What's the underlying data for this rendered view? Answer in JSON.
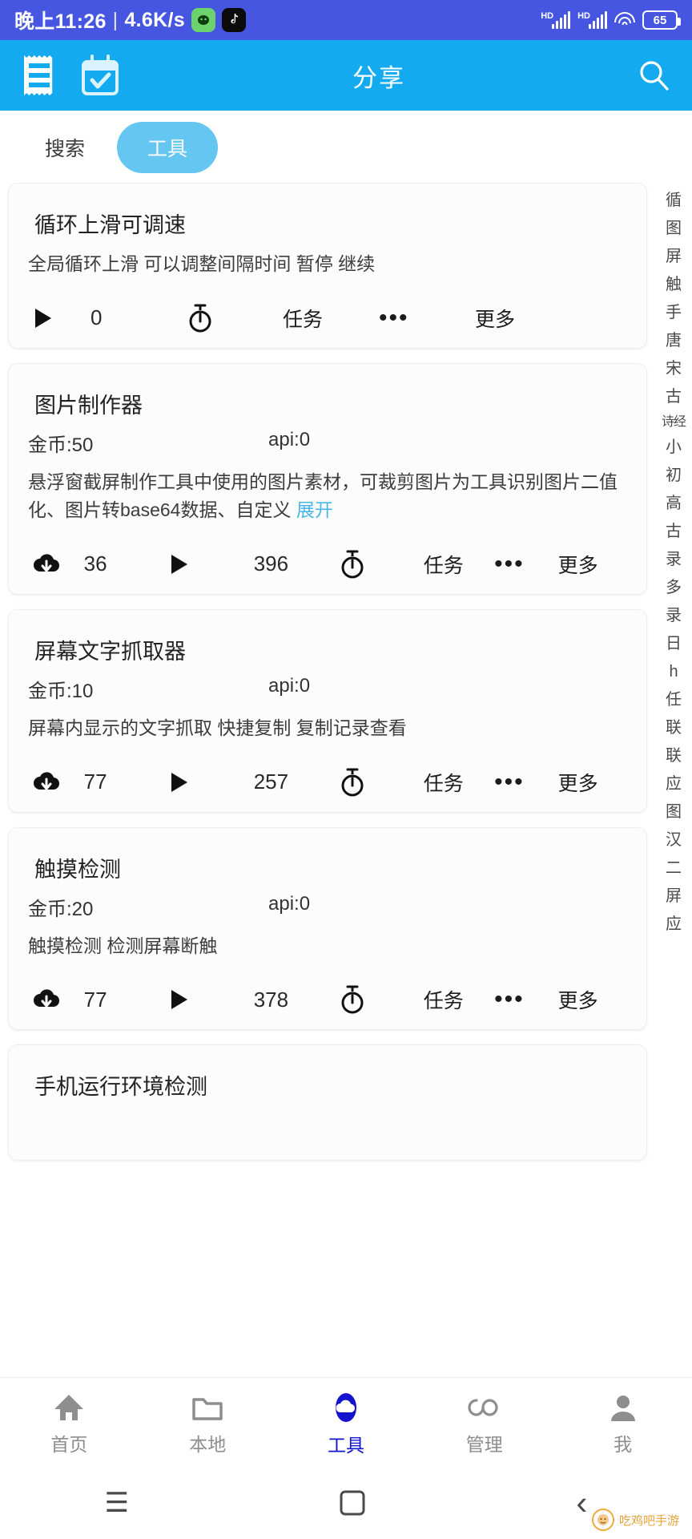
{
  "status_bar": {
    "time": "晚上11:26",
    "separator": "|",
    "network_speed": "4.6K/s",
    "app_badge_1": "app-icon",
    "app_badge_2": "tiktok-icon",
    "hd_label_1": "HD",
    "hd_label_2": "HD",
    "battery": "65"
  },
  "app_bar": {
    "title": "分享",
    "menu_icon": "receipt-list-icon",
    "calendar_icon": "calendar-check-icon",
    "search_icon": "search-icon"
  },
  "tabs": [
    {
      "label": "搜索",
      "active": false
    },
    {
      "label": "工具",
      "active": true
    }
  ],
  "cards": [
    {
      "title": "循环上滑可调速",
      "coin": "",
      "api": "",
      "desc": "全局循环上滑 可以调整间隔时间 暂停 继续",
      "expand": "",
      "download": "",
      "play": "0",
      "task": "任务",
      "dots": "•••",
      "more": "更多"
    },
    {
      "title": "图片制作器",
      "coin": "金币:50",
      "api": "api:0",
      "desc": "悬浮窗截屏制作工具中使用的图片素材，可裁剪图片为工具识别图片二值化、图片转base64数据、自定义 ",
      "expand": "展开",
      "download": "36",
      "play": "396",
      "task": "任务",
      "dots": "•••",
      "more": "更多"
    },
    {
      "title": "屏幕文字抓取器",
      "coin": "金币:10",
      "api": "api:0",
      "desc": "屏幕内显示的文字抓取 快捷复制 复制记录查看",
      "expand": "",
      "download": "77",
      "play": "257",
      "task": "任务",
      "dots": "•••",
      "more": "更多"
    },
    {
      "title": "触摸检测",
      "coin": "金币:20",
      "api": "api:0",
      "desc": "触摸检测 检测屏幕断触",
      "expand": "",
      "download": "77",
      "play": "378",
      "task": "任务",
      "dots": "•••",
      "more": "更多"
    },
    {
      "title": "手机运行环境检测",
      "coin": "",
      "api": "",
      "desc": "",
      "expand": "",
      "download": "",
      "play": "",
      "task": "",
      "dots": "",
      "more": ""
    }
  ],
  "index_rail": [
    "循",
    "图",
    "屏",
    "触",
    "手",
    "唐",
    "宋",
    "古",
    "诗经",
    "小",
    "初",
    "高",
    "古",
    "录",
    "多",
    "录",
    "日",
    "h",
    "任",
    "联",
    "联",
    "应",
    "图",
    "汉",
    "二",
    "屏",
    "应"
  ],
  "bottom_nav": [
    {
      "label": "首页",
      "icon": "home-icon",
      "active": false
    },
    {
      "label": "本地",
      "icon": "folder-icon",
      "active": false
    },
    {
      "label": "工具",
      "icon": "cloud-icon",
      "active": true
    },
    {
      "label": "管理",
      "icon": "infinity-icon",
      "active": false
    },
    {
      "label": "我",
      "icon": "person-icon",
      "active": false
    }
  ],
  "system_nav": {
    "recents": "☰",
    "home": "◻",
    "back": "‹"
  },
  "watermark": {
    "text": "吃鸡吧手游"
  },
  "colors": {
    "status_bar_bg": "#4656e0",
    "app_bar_bg": "#13aaf0",
    "tab_active_bg": "#65c6f2",
    "expand_link": "#49b6e8",
    "nav_active": "#1414cf"
  }
}
